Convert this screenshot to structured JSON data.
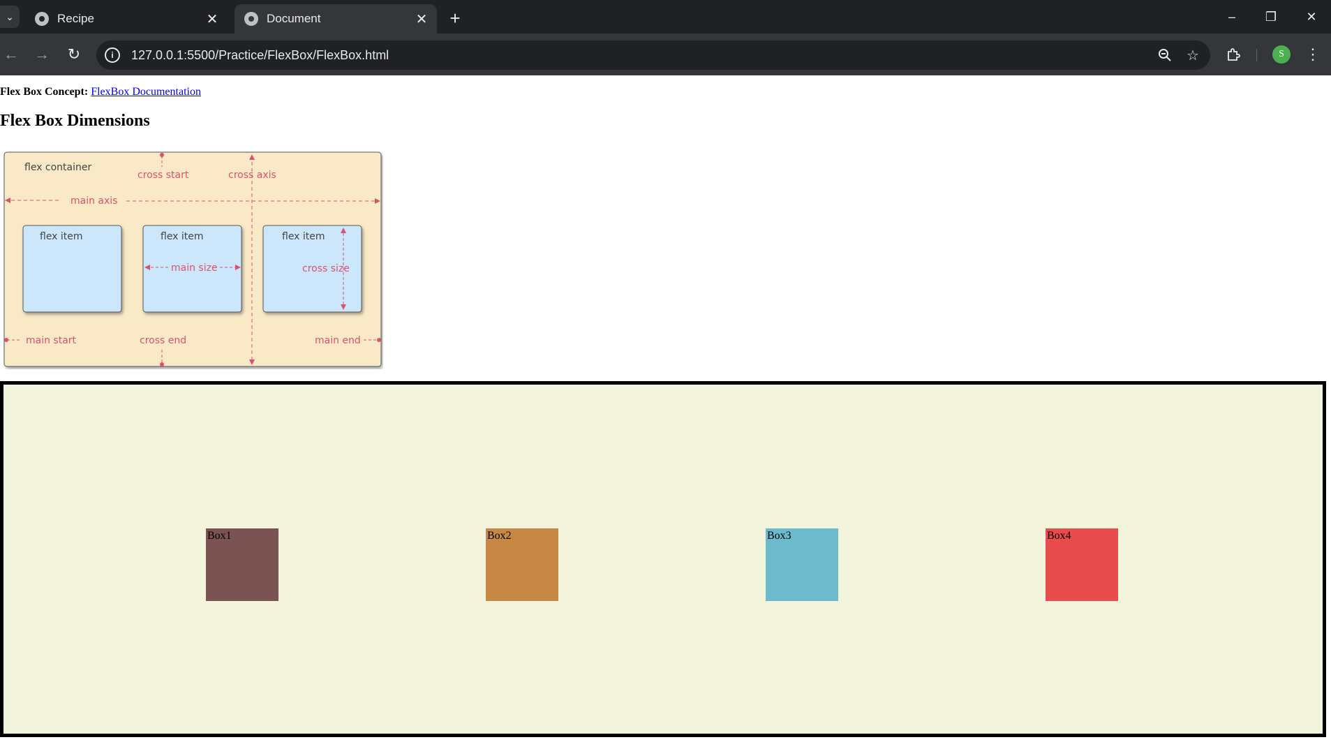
{
  "browser": {
    "tabs": [
      {
        "title": "Recipe",
        "active": false
      },
      {
        "title": "Document",
        "active": true
      }
    ],
    "url": "127.0.0.1:5500/Practice/FlexBox/FlexBox.html",
    "profile_initial": "S"
  },
  "page": {
    "concept_label": "Flex Box Concept:",
    "concept_link": "FlexBox Documentation",
    "heading": "Flex Box Dimensions",
    "diagram": {
      "container_label": "flex container",
      "cross_start": "cross start",
      "cross_axis": "cross axis",
      "main_axis": "main axis",
      "item_1": "flex item",
      "item_2": "flex item",
      "item_3": "flex item",
      "main_size": "main size",
      "cross_size": "cross size",
      "main_start": "main start",
      "cross_end": "cross end",
      "main_end": "main end"
    },
    "boxes": [
      {
        "label": "Box1",
        "color": "#7b5352"
      },
      {
        "label": "Box2",
        "color": "#c68844"
      },
      {
        "label": "Box3",
        "color": "#6dbacd"
      },
      {
        "label": "Box4",
        "color": "#e84c4c"
      }
    ],
    "container_background": "#f3f4dc"
  }
}
